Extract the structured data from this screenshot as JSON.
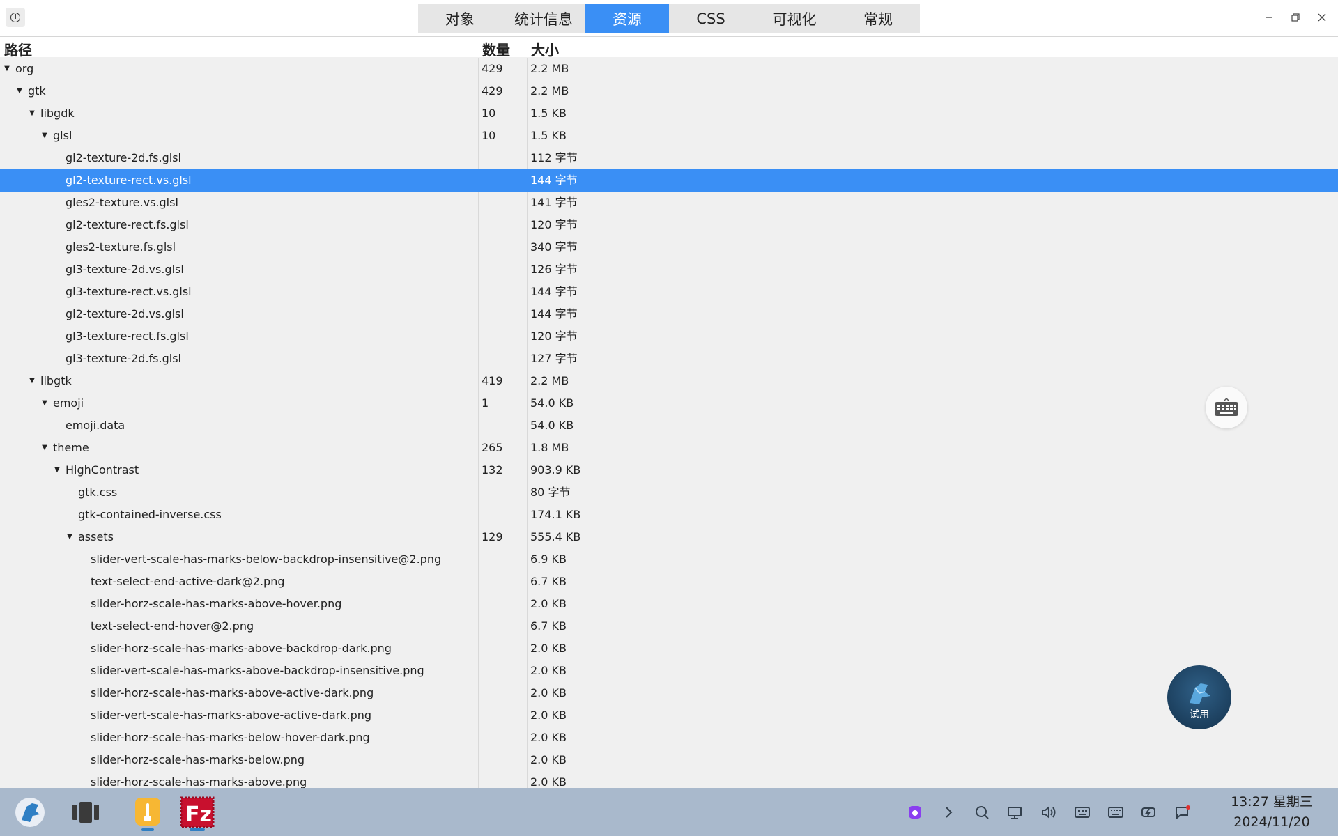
{
  "header": {
    "tabs": [
      {
        "label": "对象",
        "active": false
      },
      {
        "label": "统计信息",
        "active": false
      },
      {
        "label": "资源",
        "active": true
      },
      {
        "label": "CSS",
        "active": false
      },
      {
        "label": "可视化",
        "active": false
      },
      {
        "label": "常规",
        "active": false
      }
    ]
  },
  "columns": {
    "path": "路径",
    "count": "数量",
    "size": "大小"
  },
  "rows": [
    {
      "name": "org",
      "depth": 0,
      "expandable": true,
      "count": "429",
      "size": "2.2 MB"
    },
    {
      "name": "gtk",
      "depth": 1,
      "expandable": true,
      "count": "429",
      "size": "2.2 MB"
    },
    {
      "name": "libgdk",
      "depth": 2,
      "expandable": true,
      "count": "10",
      "size": "1.5 KB"
    },
    {
      "name": "glsl",
      "depth": 3,
      "expandable": true,
      "count": "10",
      "size": "1.5 KB"
    },
    {
      "name": "gl2-texture-2d.fs.glsl",
      "depth": 4,
      "expandable": false,
      "count": "",
      "size": "112 字节"
    },
    {
      "name": "gl2-texture-rect.vs.glsl",
      "depth": 4,
      "expandable": false,
      "count": "",
      "size": "144 字节",
      "selected": true
    },
    {
      "name": "gles2-texture.vs.glsl",
      "depth": 4,
      "expandable": false,
      "count": "",
      "size": "141 字节"
    },
    {
      "name": "gl2-texture-rect.fs.glsl",
      "depth": 4,
      "expandable": false,
      "count": "",
      "size": "120 字节"
    },
    {
      "name": "gles2-texture.fs.glsl",
      "depth": 4,
      "expandable": false,
      "count": "",
      "size": "340 字节"
    },
    {
      "name": "gl3-texture-2d.vs.glsl",
      "depth": 4,
      "expandable": false,
      "count": "",
      "size": "126 字节"
    },
    {
      "name": "gl3-texture-rect.vs.glsl",
      "depth": 4,
      "expandable": false,
      "count": "",
      "size": "144 字节"
    },
    {
      "name": "gl2-texture-2d.vs.glsl",
      "depth": 4,
      "expandable": false,
      "count": "",
      "size": "144 字节"
    },
    {
      "name": "gl3-texture-rect.fs.glsl",
      "depth": 4,
      "expandable": false,
      "count": "",
      "size": "120 字节"
    },
    {
      "name": "gl3-texture-2d.fs.glsl",
      "depth": 4,
      "expandable": false,
      "count": "",
      "size": "127 字节"
    },
    {
      "name": "libgtk",
      "depth": 2,
      "expandable": true,
      "count": "419",
      "size": "2.2 MB"
    },
    {
      "name": "emoji",
      "depth": 3,
      "expandable": true,
      "count": "1",
      "size": "54.0 KB"
    },
    {
      "name": "emoji.data",
      "depth": 4,
      "expandable": false,
      "count": "",
      "size": "54.0 KB"
    },
    {
      "name": "theme",
      "depth": 3,
      "expandable": true,
      "count": "265",
      "size": "1.8 MB"
    },
    {
      "name": "HighContrast",
      "depth": 4,
      "expandable": true,
      "count": "132",
      "size": "903.9 KB"
    },
    {
      "name": "gtk.css",
      "depth": 5,
      "expandable": false,
      "count": "",
      "size": "80 字节"
    },
    {
      "name": "gtk-contained-inverse.css",
      "depth": 5,
      "expandable": false,
      "count": "",
      "size": "174.1 KB"
    },
    {
      "name": "assets",
      "depth": 5,
      "expandable": true,
      "count": "129",
      "size": "555.4 KB"
    },
    {
      "name": "slider-vert-scale-has-marks-below-backdrop-insensitive@2.png",
      "depth": 6,
      "expandable": false,
      "count": "",
      "size": "6.9 KB"
    },
    {
      "name": "text-select-end-active-dark@2.png",
      "depth": 6,
      "expandable": false,
      "count": "",
      "size": "6.7 KB"
    },
    {
      "name": "slider-horz-scale-has-marks-above-hover.png",
      "depth": 6,
      "expandable": false,
      "count": "",
      "size": "2.0 KB"
    },
    {
      "name": "text-select-end-hover@2.png",
      "depth": 6,
      "expandable": false,
      "count": "",
      "size": "6.7 KB"
    },
    {
      "name": "slider-horz-scale-has-marks-above-backdrop-dark.png",
      "depth": 6,
      "expandable": false,
      "count": "",
      "size": "2.0 KB"
    },
    {
      "name": "slider-vert-scale-has-marks-above-backdrop-insensitive.png",
      "depth": 6,
      "expandable": false,
      "count": "",
      "size": "2.0 KB"
    },
    {
      "name": "slider-horz-scale-has-marks-above-active-dark.png",
      "depth": 6,
      "expandable": false,
      "count": "",
      "size": "2.0 KB"
    },
    {
      "name": "slider-vert-scale-has-marks-above-active-dark.png",
      "depth": 6,
      "expandable": false,
      "count": "",
      "size": "2.0 KB"
    },
    {
      "name": "slider-horz-scale-has-marks-below-hover-dark.png",
      "depth": 6,
      "expandable": false,
      "count": "",
      "size": "2.0 KB"
    },
    {
      "name": "slider-horz-scale-has-marks-below.png",
      "depth": 6,
      "expandable": false,
      "count": "",
      "size": "2.0 KB"
    },
    {
      "name": "slider-horz-scale-has-marks-above.png",
      "depth": 6,
      "expandable": false,
      "count": "",
      "size": "2.0 KB"
    }
  ],
  "floating": {
    "trial_label": "试用"
  },
  "taskbar": {
    "time": "13:27 星期三",
    "date": "2024/11/20",
    "apps": [
      "launcher-icon",
      "multitask-icon",
      "file-manager-icon",
      "filezilla-icon"
    ]
  },
  "colors": {
    "accent": "#3a8ff5",
    "taskbar": "#a9b9cc",
    "filezilla_red": "#c8102e"
  }
}
